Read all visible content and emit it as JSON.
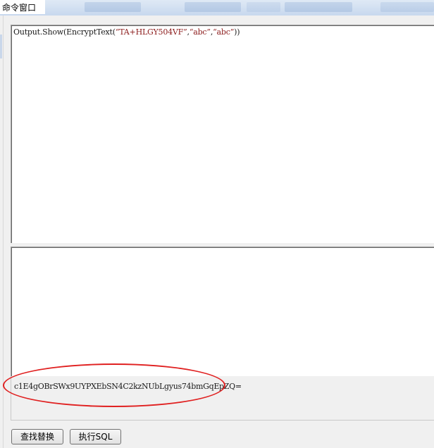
{
  "window": {
    "title": "命令窗口"
  },
  "editor": {
    "code_prefix": "Output.Show(EncryptText(",
    "arg1": "“TA+HLGY504VF”",
    "sep1": ",",
    "arg2": "“abc”",
    "sep2": ",",
    "arg3": "“abc”",
    "code_suffix": "))"
  },
  "output": {
    "result": "c1E4gOBrSWx9UYPXEbSN4C2kzNUbLgyus74bmGqEpZQ="
  },
  "buttons": {
    "find_replace": "查找替换",
    "execute_sql": "执行SQL"
  },
  "colors": {
    "highlight": "#e02020",
    "string_literal": "#8b1a1a"
  }
}
